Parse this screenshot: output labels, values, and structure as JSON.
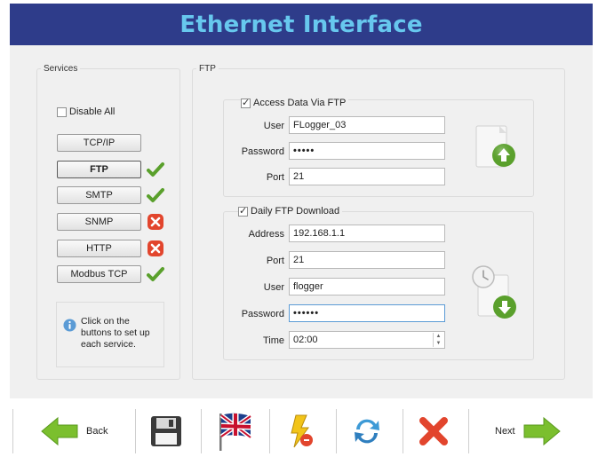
{
  "header": {
    "title": "Ethernet Interface"
  },
  "services": {
    "legend": "Services",
    "disable_all": "Disable All",
    "items": [
      {
        "label": "TCP/IP",
        "status": ""
      },
      {
        "label": "FTP",
        "status": "enabled"
      },
      {
        "label": "SMTP",
        "status": "enabled"
      },
      {
        "label": "SNMP",
        "status": "disabled"
      },
      {
        "label": "HTTP",
        "status": "disabled"
      },
      {
        "label": "Modbus TCP",
        "status": "enabled"
      }
    ],
    "info": "Click on the buttons to set up each service."
  },
  "ftp": {
    "legend": "FTP",
    "access": {
      "checkbox_label": "Access Data Via FTP",
      "checked": true,
      "user_label": "User",
      "user_value": "FLogger_03",
      "password_label": "Password",
      "password_value": "•••••",
      "port_label": "Port",
      "port_value": "21"
    },
    "daily": {
      "checkbox_label": "Daily FTP Download",
      "checked": true,
      "address_label": "Address",
      "address_value": "192.168.1.1",
      "port_label": "Port",
      "port_value": "21",
      "user_label": "User",
      "user_value": "flogger",
      "password_label": "Password",
      "password_value": "••••••",
      "time_label": "Time",
      "time_value": "02:00"
    }
  },
  "toolbar": {
    "back_label": "Back",
    "next_label": "Next"
  },
  "colors": {
    "header_bg": "#2e3c8a",
    "header_text": "#67c8ee",
    "check_green": "#5aa02c",
    "cross_red": "#e2452d"
  }
}
